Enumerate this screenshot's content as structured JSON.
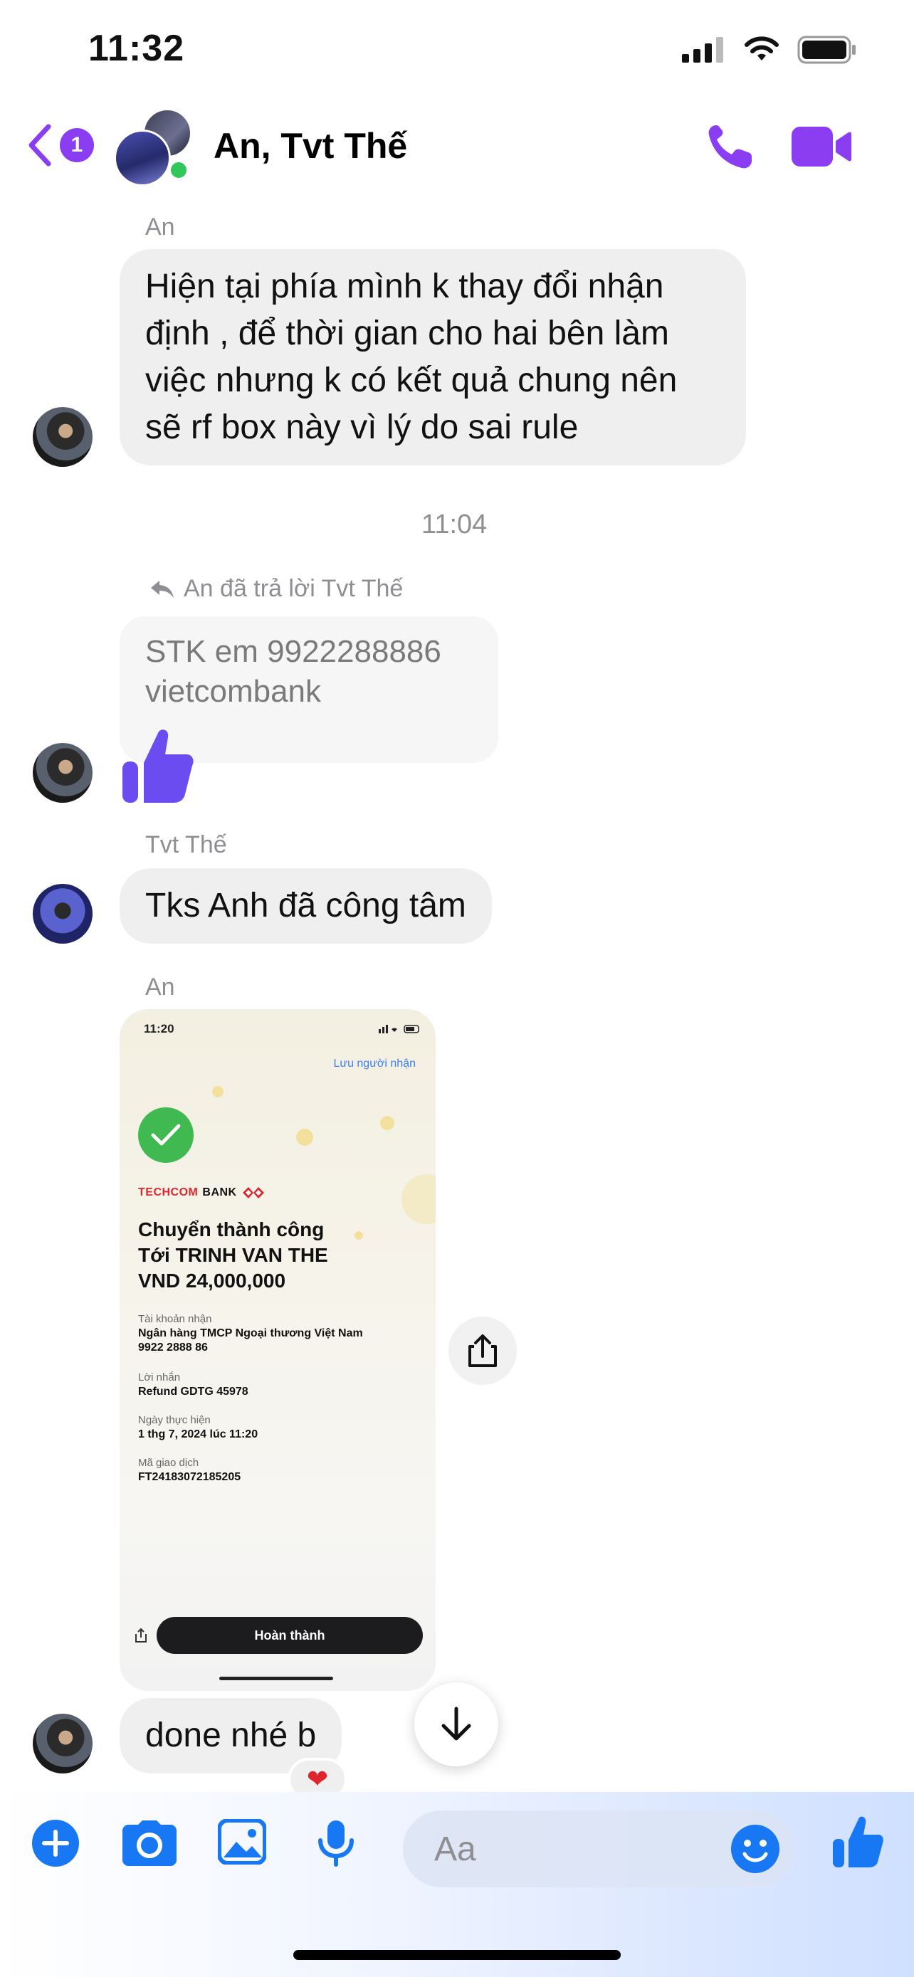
{
  "status_bar": {
    "time": "11:32"
  },
  "header": {
    "back_count": "1",
    "title": "An, Tvt Thế"
  },
  "messages": {
    "m1": {
      "sender": "An",
      "text": "Hiện tại phía mình k thay đổi nhận định , để thời gian cho hai bên làm việc nhưng k có kết quả chung nên sẽ rf box này vì lý do sai rule"
    },
    "timestamp": "11:04",
    "m2": {
      "reply_label": "An đã trả lời Tvt Thế",
      "quoted_text": "STK em 9922288886 vietcombank"
    },
    "m3": {
      "sender": "Tvt Thế",
      "text": "Tks Anh đã công tâm"
    },
    "m4": {
      "sender": "An"
    },
    "m5": {
      "text": "done nhé b",
      "reaction": "❤"
    }
  },
  "receipt": {
    "time": "11:20",
    "save_recipient": "Lưu người nhận",
    "bank_name_red": "TECHCOM",
    "bank_name_black": "BANK",
    "headline_1": "Chuyển thành công",
    "headline_2": "Tới TRINH VAN THE",
    "headline_3": "VND 24,000,000",
    "account_label": "Tài khoản nhận",
    "account_bank": "Ngân hàng TMCP Ngoại thương Việt Nam",
    "account_number": "9922 2888 86",
    "note_label": "Lời nhắn",
    "note_value": "Refund GDTG 45978",
    "date_label": "Ngày thực hiện",
    "date_value": "1 thg 7, 2024 lúc 11:20",
    "txn_label": "Mã giao dịch",
    "txn_value": "FT24183072185205",
    "done_button": "Hoàn thành"
  },
  "composer": {
    "placeholder": "Aa"
  },
  "colors": {
    "accent": "#8b3df2",
    "messenger_blue": "#1877f2",
    "like_purple": "#6b4cf0"
  }
}
